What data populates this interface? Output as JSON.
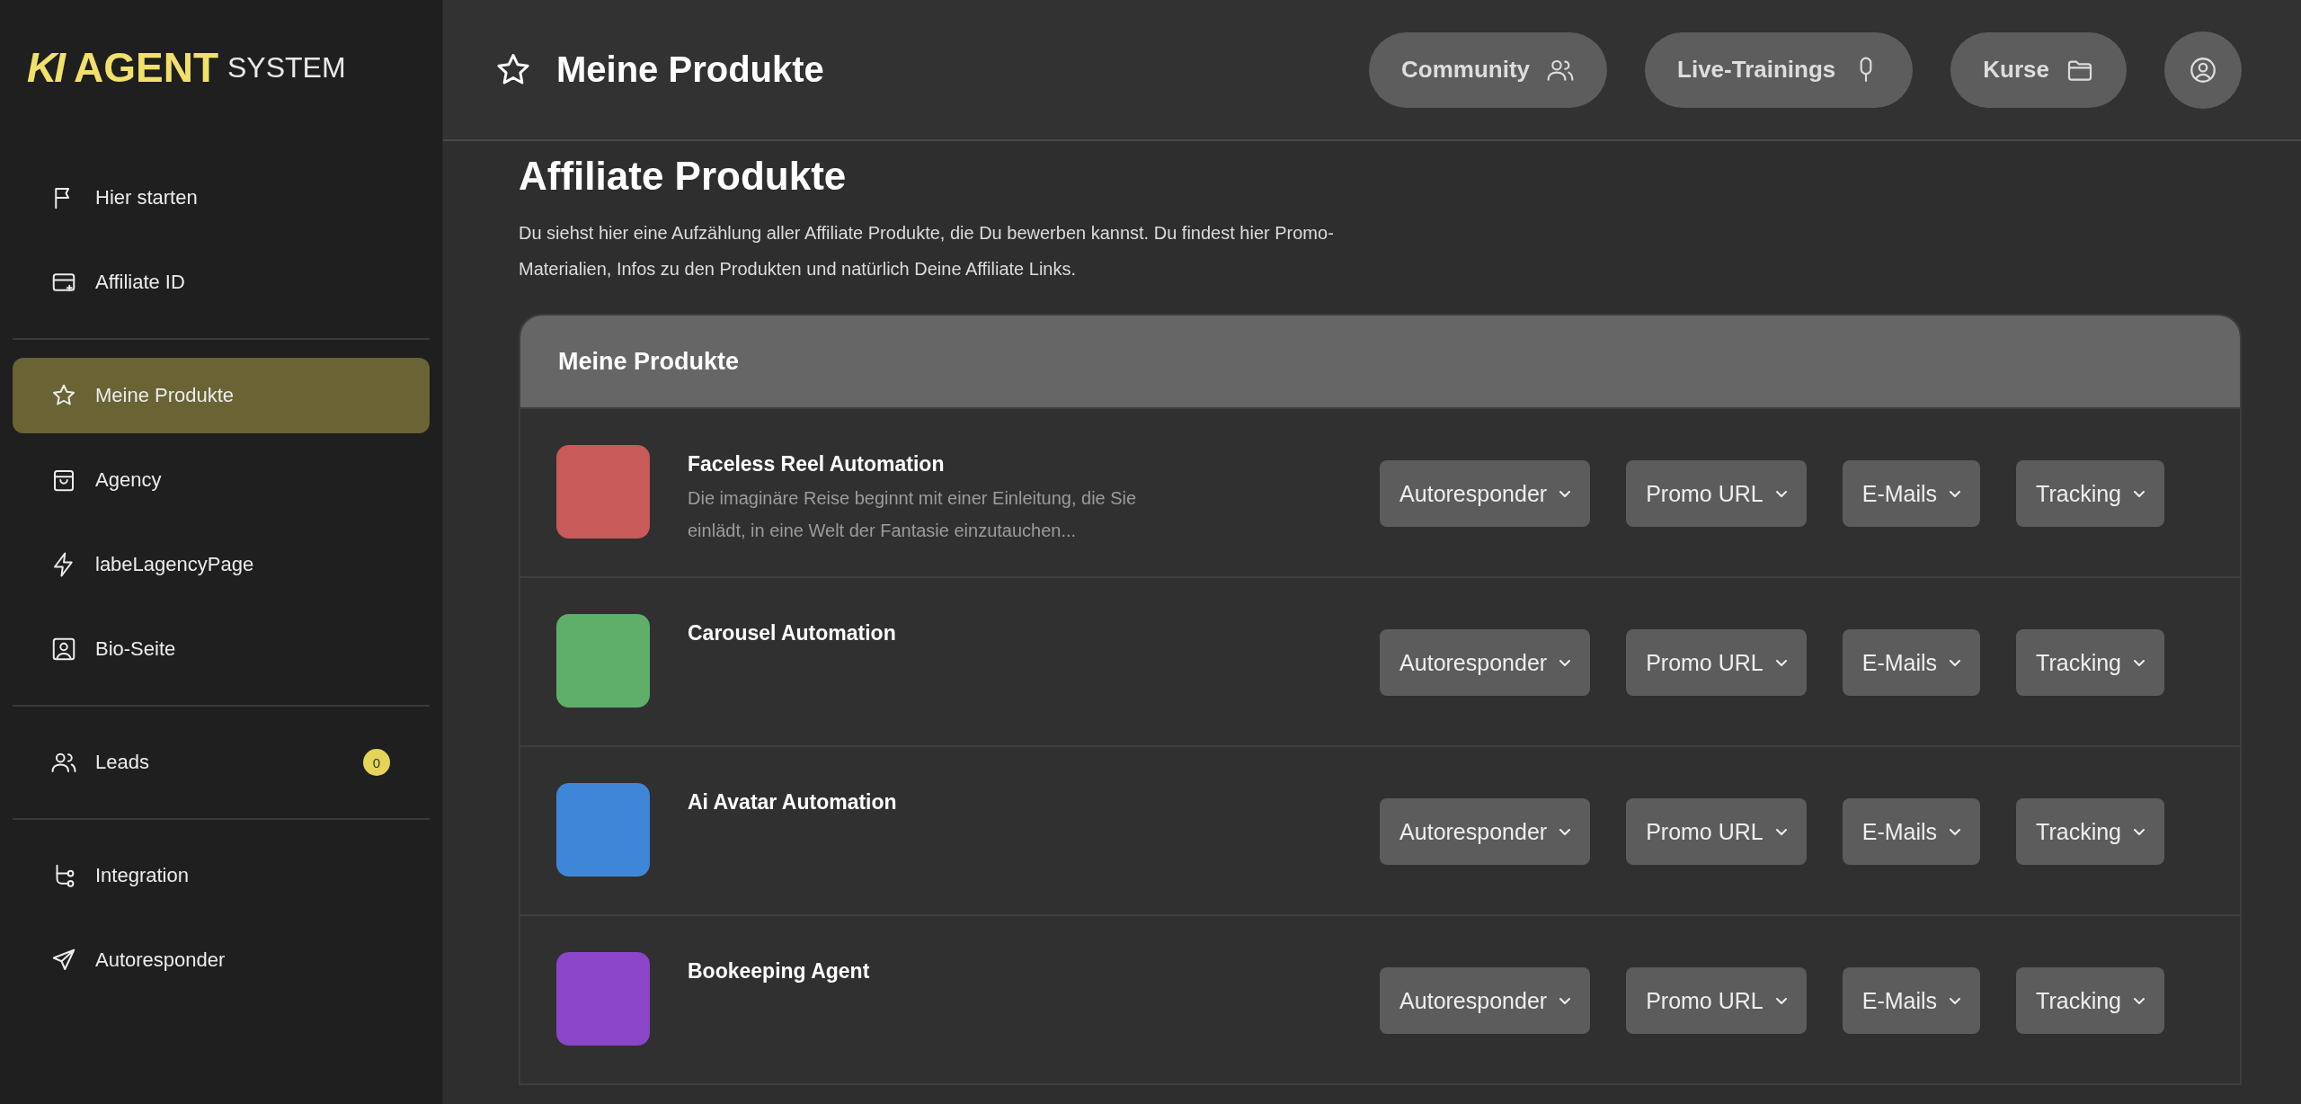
{
  "logo": {
    "mark": "KI",
    "brand": "AGENT",
    "suffix": "SYSTEM"
  },
  "sidebar": {
    "groups": [
      [
        {
          "label": "Hier starten",
          "selected": false
        },
        {
          "label": "Affiliate ID",
          "selected": false
        }
      ],
      [
        {
          "label": "Meine Produkte",
          "selected": true
        },
        {
          "label": "Agency",
          "selected": false
        },
        {
          "label": "labeLagencyPage",
          "selected": false
        },
        {
          "label": "Bio-Seite",
          "selected": false
        }
      ],
      [
        {
          "label": "Leads",
          "selected": false,
          "badge": "0"
        }
      ],
      [
        {
          "label": "Integration",
          "selected": false
        },
        {
          "label": "Autoresponder",
          "selected": false
        }
      ]
    ]
  },
  "header": {
    "title": "Meine Produkte",
    "links": [
      {
        "label": "Community"
      },
      {
        "label": "Live-Trainings"
      },
      {
        "label": "Kurse"
      }
    ]
  },
  "page": {
    "heading": "Affiliate Produkte",
    "description": "Du siehst hier eine Aufzählung aller Affiliate Produkte, die Du bewerben kannst. Du findest hier Promo-Materialien, Infos zu den Produkten und natürlich Deine Affiliate Links."
  },
  "products": {
    "title": "Meine Produkte",
    "rows": [
      {
        "name": "Faceless Reel Automation",
        "description": "Die imaginäre Reise beginnt mit einer Einleitung, die Sie einlädt, in eine Welt der Fantasie einzutauchen...",
        "color": "#c85a5a",
        "actions": [
          "Autoresponder",
          "Promo URL",
          "E-Mails",
          "Tracking"
        ]
      },
      {
        "name": "Carousel Automation",
        "color": "#5fae6a",
        "actions": [
          "Autoresponder",
          "Promo URL",
          "E-Mails",
          "Tracking"
        ]
      },
      {
        "name": "Ai Avatar Automation",
        "color": "#3f86d8",
        "actions": [
          "Autoresponder",
          "Promo URL",
          "E-Mails",
          "Tracking"
        ]
      },
      {
        "name": "Bookeeping Agent",
        "color": "#8a45c8",
        "actions": [
          "Autoresponder",
          "Promo URL",
          "E-Mails",
          "Tracking"
        ]
      }
    ]
  }
}
